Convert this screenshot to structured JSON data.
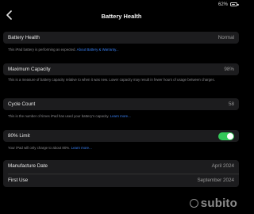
{
  "status": {
    "battery_pct": "62%"
  },
  "nav": {
    "title": "Battery Health"
  },
  "battery_health": {
    "label": "Battery Health",
    "value": "Normal",
    "note": "This iPad battery is performing as expected.",
    "note_link": "About Battery & Warranty..."
  },
  "max_capacity": {
    "label": "Maximum Capacity",
    "value": "98%",
    "note": "This is a measure of battery capacity relative to when it was new. Lower capacity may result in fewer hours of usage between charges."
  },
  "cycle_count": {
    "label": "Cycle Count",
    "value": "58",
    "note": "This is the number of times iPad has used your battery's capacity.",
    "note_link": "Learn more..."
  },
  "limit": {
    "label": "80% Limit",
    "enabled": true,
    "note": "Your iPad will only charge to about 80%.",
    "note_link": "Learn more..."
  },
  "info": {
    "manufacture_label": "Manufacture Date",
    "manufacture_value": "April 2024",
    "first_use_label": "First Use",
    "first_use_value": "September 2024"
  },
  "watermark": {
    "text": "subito"
  },
  "colors": {
    "accent_link": "#3a82f7",
    "toggle_on": "#34c759",
    "card_bg": "#1c1c1e"
  }
}
